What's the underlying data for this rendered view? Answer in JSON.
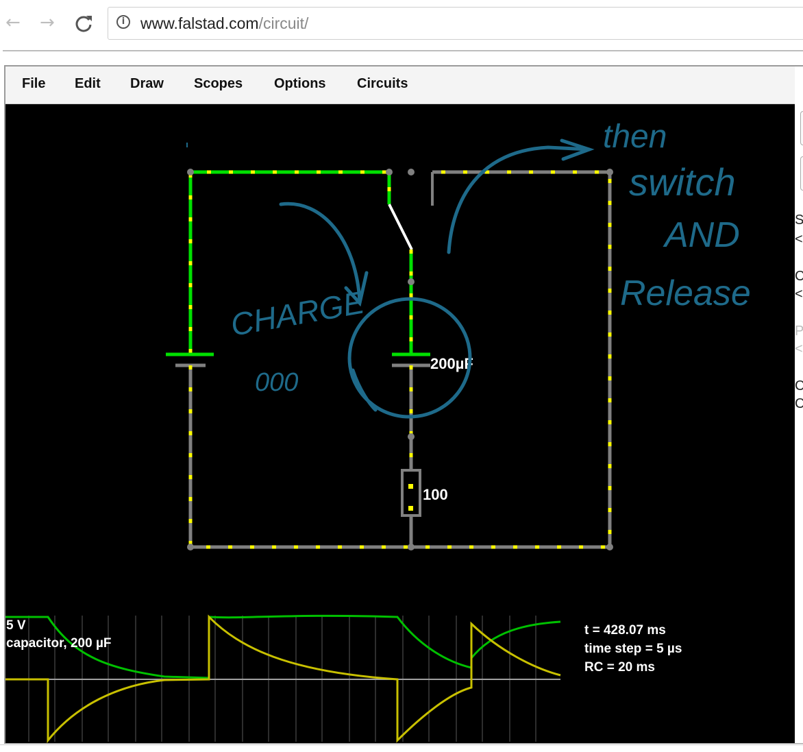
{
  "browser": {
    "url_host": "www.falstad.com",
    "url_path": "/circuit/",
    "back_glyph": "←",
    "forward_glyph": "→",
    "reload_glyph": "C",
    "info_glyph": "i"
  },
  "menu": {
    "items": [
      "File",
      "Edit",
      "Draw",
      "Scopes",
      "Options",
      "Circuits"
    ]
  },
  "circuit": {
    "capacitor_label": "200µF",
    "resistor_label": "100",
    "colors": {
      "hot_wire": "#00e000",
      "ground_wire": "#808080",
      "current_dot": "#ffff00",
      "annotation": "#1e6a8a"
    }
  },
  "annotations": {
    "charge": "CHARGE",
    "charge_dots": "000",
    "then": "then",
    "switch": "switch",
    "and": "AND",
    "release": "Release"
  },
  "scope": {
    "voltage_label": "5 V",
    "trace_label": "capacitor, 200 µF",
    "info_lines": [
      "t = 428.07 ms",
      "time step = 5 µs",
      "RC = 20 ms"
    ]
  },
  "right_panel": {
    "letters": [
      "S",
      "<",
      "C",
      "<",
      "P",
      "<",
      "C",
      "C"
    ]
  }
}
